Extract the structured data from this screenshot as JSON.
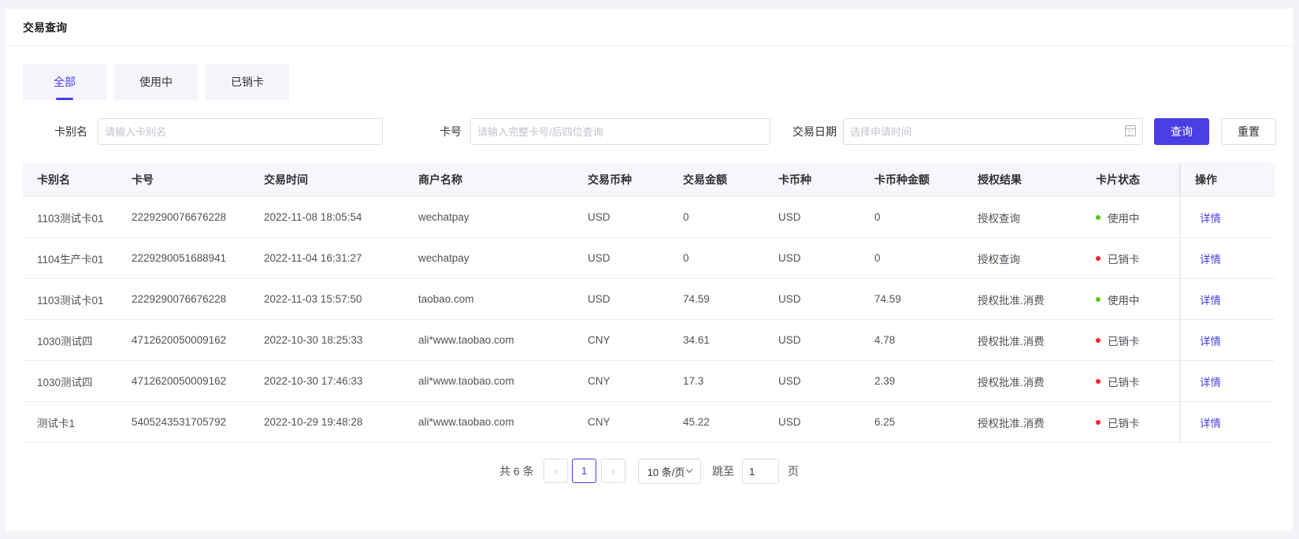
{
  "header": {
    "title": "交易查询"
  },
  "tabs": [
    {
      "label": "全部",
      "active": true
    },
    {
      "label": "使用中",
      "active": false
    },
    {
      "label": "已销卡",
      "active": false
    }
  ],
  "filters": {
    "alias_label": "卡别名",
    "alias_placeholder": "请输入卡别名",
    "alias_value": "",
    "card_label": "卡号",
    "card_placeholder": "请输入完整卡号/后四位查询",
    "card_value": "",
    "date_label": "交易日期",
    "date_placeholder": "选择申请时间",
    "date_value": "",
    "search_label": "查询",
    "reset_label": "重置"
  },
  "table": {
    "columns": [
      "卡别名",
      "卡号",
      "交易时间",
      "商户名称",
      "交易币种",
      "交易金额",
      "卡币种",
      "卡币种金额",
      "授权结果",
      "卡片状态",
      "操作"
    ],
    "rows": [
      {
        "alias": "1103测试卡01",
        "card": "2229290076676228",
        "time": "2022-11-08 18:05:54",
        "merchant": "wechatpay",
        "currency": "USD",
        "amount": "0",
        "card_currency": "USD",
        "card_amount": "0",
        "auth": "授权查询",
        "status": "使用中",
        "status_color": "#52c41a",
        "action": "详情"
      },
      {
        "alias": "1104生产卡01",
        "card": "2229290051688941",
        "time": "2022-11-04 16:31:27",
        "merchant": "wechatpay",
        "currency": "USD",
        "amount": "0",
        "card_currency": "USD",
        "card_amount": "0",
        "auth": "授权查询",
        "status": "已销卡",
        "status_color": "#f5222d",
        "action": "详情"
      },
      {
        "alias": "1103测试卡01",
        "card": "2229290076676228",
        "time": "2022-11-03 15:57:50",
        "merchant": "taobao.com",
        "currency": "USD",
        "amount": "74.59",
        "card_currency": "USD",
        "card_amount": "74.59",
        "auth": "授权批准.消费",
        "status": "使用中",
        "status_color": "#52c41a",
        "action": "详情"
      },
      {
        "alias": "1030测试四",
        "card": "4712620050009162",
        "time": "2022-10-30 18:25:33",
        "merchant": "ali*www.taobao.com",
        "currency": "CNY",
        "amount": "34.61",
        "card_currency": "USD",
        "card_amount": "4.78",
        "auth": "授权批准.消费",
        "status": "已销卡",
        "status_color": "#f5222d",
        "action": "详情"
      },
      {
        "alias": "1030测试四",
        "card": "4712620050009162",
        "time": "2022-10-30 17:46:33",
        "merchant": "ali*www.taobao.com",
        "currency": "CNY",
        "amount": "17.3",
        "card_currency": "USD",
        "card_amount": "2.39",
        "auth": "授权批准.消费",
        "status": "已销卡",
        "status_color": "#f5222d",
        "action": "详情"
      },
      {
        "alias": "测试卡1",
        "card": "5405243531705792",
        "time": "2022-10-29 19:48:28",
        "merchant": "ali*www.taobao.com",
        "currency": "CNY",
        "amount": "45.22",
        "card_currency": "USD",
        "card_amount": "6.25",
        "auth": "授权批准.消费",
        "status": "已销卡",
        "status_color": "#f5222d",
        "action": "详情"
      }
    ]
  },
  "pagination": {
    "total_text": "共 6 条",
    "prev_icon": "chevron-left-icon",
    "current_page": "1",
    "next_icon": "chevron-right-icon",
    "page_size": "10 条/页",
    "jump_label": "跳至",
    "jump_value": "1",
    "page_suffix": "页"
  },
  "colors": {
    "accent": "#4a3ee6",
    "status_active": "#52c41a",
    "status_cancelled": "#f5222d"
  }
}
